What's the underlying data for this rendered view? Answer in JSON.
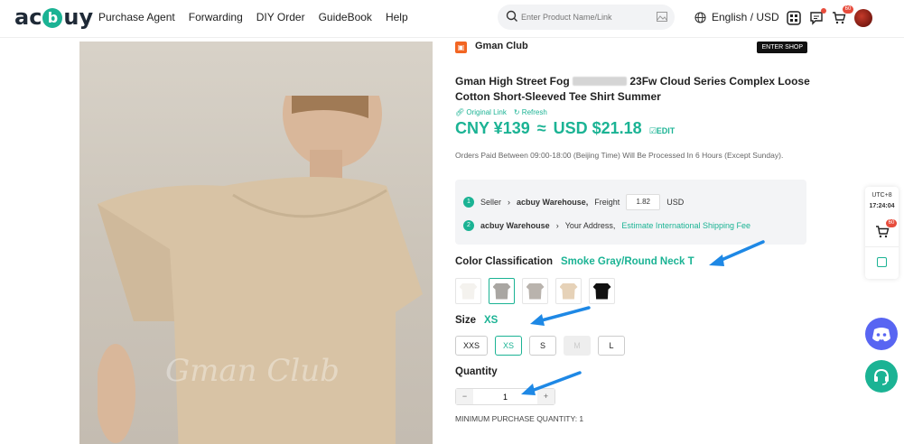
{
  "header": {
    "logo_left": "ac",
    "logo_mid": "b",
    "logo_right": "uy",
    "nav": [
      "Purchase Agent",
      "Forwarding",
      "DIY Order",
      "GuideBook",
      "Help"
    ],
    "search_placeholder": "Enter Product Name/Link",
    "language": "English / USD",
    "cart_count": "60"
  },
  "product": {
    "watermark": "Gman Club",
    "store_name": "Gman Club",
    "enter_shop": "ENTER SHOP",
    "title_part1": "Gman High Street Fog",
    "title_part2": "23Fw Cloud Series Complex Loose Cotton Short-Sleeved Tee Shirt Summer",
    "original_link": "Original Link",
    "refresh": "Refresh",
    "price_cny": "CNY ¥139",
    "approx": "≈",
    "price_usd": "USD $21.18",
    "edit": "EDIT",
    "notice": "Orders Paid Between 09:00-18:00 (Beijing Time) Will Be Processed In 6 Hours (Except Sunday)."
  },
  "shipping": {
    "step1_num": "1",
    "seller": "Seller",
    "warehouse": "acbuy Warehouse,",
    "freight_label": "Freight",
    "freight_value": "1.82",
    "freight_currency": "USD",
    "step2_num": "2",
    "warehouse2": "acbuy Warehouse",
    "address": "Your Address,",
    "estimate": "Estimate International Shipping Fee"
  },
  "options": {
    "color_label": "Color Classification",
    "color_selected": "Smoke Gray/Round Neck T",
    "colors": [
      "#f4f2ee",
      "#a9a6a2",
      "#b9b3ad",
      "#e6d2b8",
      "#111111"
    ],
    "size_label": "Size",
    "size_selected": "XS",
    "sizes": [
      "XXS",
      "XS",
      "S",
      "M",
      "L"
    ],
    "quantity_label": "Quantity",
    "quantity": "1",
    "minimum": "MINIMUM PURCHASE QUANTITY: 1"
  },
  "floating": {
    "tz": "UTC+8",
    "time": "17:24:04",
    "cart_count": "60"
  }
}
